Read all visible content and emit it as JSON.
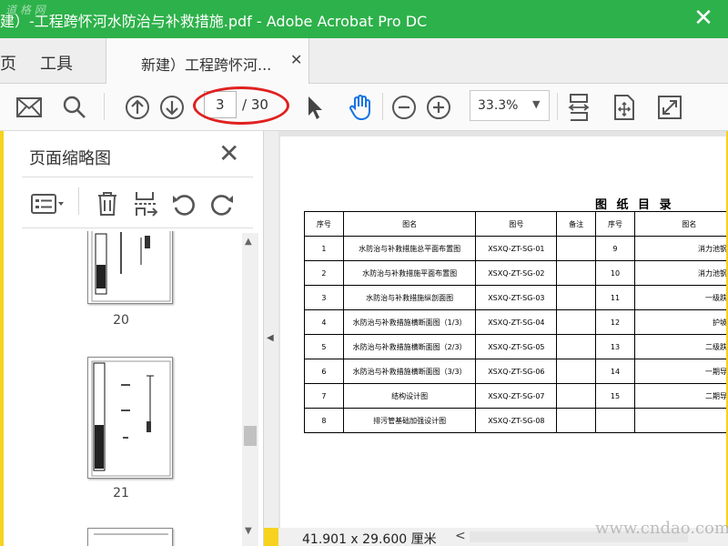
{
  "window": {
    "title": "建）-工程跨怀河水防治与补救措施.pdf - Adobe Acrobat Pro DC",
    "close_glyph": "✕",
    "corner_watermark": "道 格 网"
  },
  "tabs": {
    "home": "页",
    "tools": "工具",
    "document": "新建）工程跨怀河...",
    "document_close": "✕"
  },
  "toolbar": {
    "current_page": "3",
    "total_pages": "/ 30",
    "zoom": "33.3%",
    "zoom_arrow": "▼"
  },
  "thumbnail_panel": {
    "title": "页面缩略图",
    "close_glyph": "✕",
    "pages": [
      "20",
      "21"
    ],
    "scroll_up": "▲",
    "scroll_down": "▼",
    "collapse_arrow": "◀"
  },
  "document": {
    "table_title": "图 纸 目 录",
    "headers": [
      "序号",
      "图名",
      "图号",
      "备注",
      "序号",
      "图名"
    ],
    "rows": [
      [
        "1",
        "水防治与补救措施总平面布置图",
        "XSXQ-ZT-SG-01",
        "",
        "9",
        "消力池钢筋图"
      ],
      [
        "2",
        "水防治与补救措施平面布置图",
        "XSXQ-ZT-SG-02",
        "",
        "10",
        "消力池钢筋图"
      ],
      [
        "3",
        "水防治与补救措施纵剖面图",
        "XSXQ-ZT-SG-03",
        "",
        "11",
        "一级跌水钢"
      ],
      [
        "4",
        "水防治与补救措施横断面图（1/3）",
        "XSXQ-ZT-SG-04",
        "",
        "12",
        "护坡钢筋"
      ],
      [
        "5",
        "水防治与补救措施横断面图（2/3）",
        "XSXQ-ZT-SG-05",
        "",
        "13",
        "二级跌水钢"
      ],
      [
        "6",
        "水防治与补救措施横断面图（3/3）",
        "XSXQ-ZT-SG-06",
        "",
        "14",
        "一期导流布"
      ],
      [
        "7",
        "结构设计图",
        "XSXQ-ZT-SG-07",
        "",
        "15",
        "二期导流布"
      ],
      [
        "8",
        "排污管基础加强设计图",
        "XSXQ-ZT-SG-08",
        "",
        "",
        ""
      ]
    ]
  },
  "status": {
    "dimensions": "41.901 x 29.600 厘米",
    "scroll_left": "<",
    "watermark": "www.cndao.com"
  },
  "colors": {
    "titlebar": "#2db14a",
    "frame": "#f7d21f",
    "annotation": "#e02020",
    "hand_tool": "#1473e6"
  }
}
